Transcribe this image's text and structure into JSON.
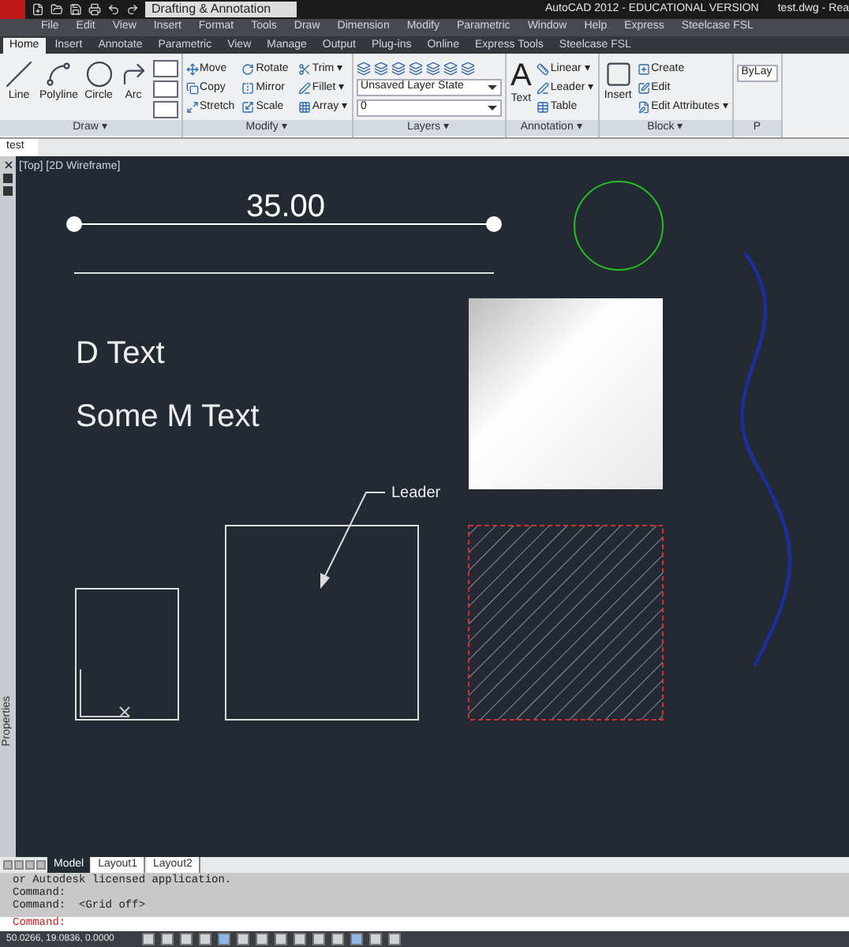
{
  "title_bar": {
    "workspace": "Drafting & Annotation",
    "title": "AutoCAD 2012 - EDUCATIONAL VERSION",
    "file": "test.dwg - Rea"
  },
  "menu_bar": [
    "File",
    "Edit",
    "View",
    "Insert",
    "Format",
    "Tools",
    "Draw",
    "Dimension",
    "Modify",
    "Parametric",
    "Window",
    "Help",
    "Express",
    "Steelcase FSL"
  ],
  "ribbon_tabs": [
    {
      "label": "Home",
      "selected": true
    },
    {
      "label": "Insert",
      "selected": false
    },
    {
      "label": "Annotate",
      "selected": false
    },
    {
      "label": "Parametric",
      "selected": false
    },
    {
      "label": "View",
      "selected": false
    },
    {
      "label": "Manage",
      "selected": false
    },
    {
      "label": "Output",
      "selected": false
    },
    {
      "label": "Plug-ins",
      "selected": false
    },
    {
      "label": "Online",
      "selected": false
    },
    {
      "label": "Express Tools",
      "selected": false
    },
    {
      "label": "Steelcase FSL",
      "selected": false
    }
  ],
  "ribbon_panels": [
    {
      "title": "Draw ▾",
      "large": [
        "Line",
        "Polyline",
        "Circle",
        "Arc"
      ]
    },
    {
      "title": "Modify ▾",
      "small": [
        "Move",
        "Rotate",
        "Trim ▾",
        "Copy",
        "Mirror",
        "Fillet ▾",
        "Stretch",
        "Scale",
        "Array ▾"
      ]
    },
    {
      "title": "Layers ▾",
      "dropdowns": [
        "Unsaved Layer State",
        "0"
      ]
    },
    {
      "title": "Annotation ▾",
      "icon_glyph": "A",
      "large": [
        "Text"
      ],
      "small": [
        "Linear ▾",
        "Leader ▾",
        "Table"
      ]
    },
    {
      "title": "Block ▾",
      "large": [
        "Insert"
      ],
      "small": [
        "Create",
        "Edit",
        "Edit Attributes ▾"
      ]
    },
    {
      "title": "P",
      "dropdowns": [
        "ByLay"
      ]
    }
  ],
  "file_tabs": [
    {
      "label": "test",
      "selected": true
    }
  ],
  "viewport": {
    "label": "[Top] [2D Wireframe]",
    "dimension": "35.00",
    "dtext": "D Text",
    "mtext": "Some M Text",
    "leader": "Leader"
  },
  "palette": {
    "label": "Properties"
  },
  "layout_tabs": [
    {
      "label": "Model",
      "selected": true
    },
    {
      "label": "Layout1",
      "selected": false
    },
    {
      "label": "Layout2",
      "selected": false
    }
  ],
  "command_history": [
    "or Autodesk licensed application.",
    "Command:",
    "Command:  <Grid off>"
  ],
  "command_prompt": "Command:",
  "status_bar": {
    "coordinates": "50.0266, 19.0836, 0.0000"
  }
}
